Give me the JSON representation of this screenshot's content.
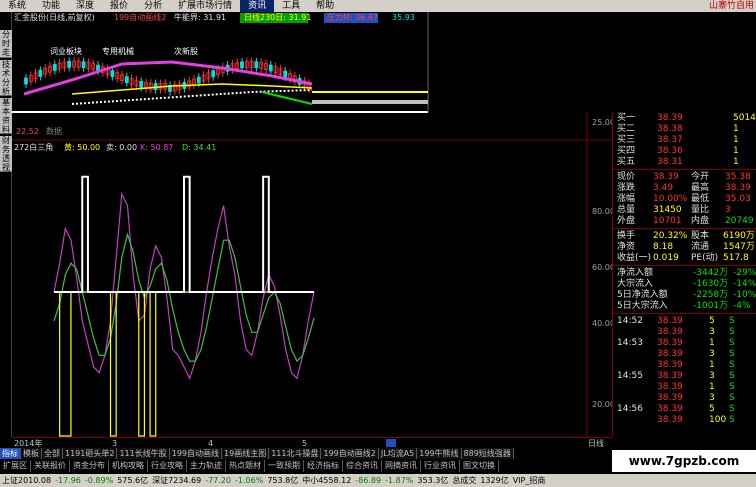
{
  "menu": {
    "items": [
      "系统",
      "功能",
      "深度",
      "报价",
      "分析",
      "扩展市场行情",
      "资讯",
      "工具",
      "帮助"
    ],
    "active_index": 6,
    "brand": "山寨竹自用"
  },
  "left_tabs": [
    "分时走势",
    "技术分析",
    "基本资料",
    "财务透视"
  ],
  "chart": {
    "title": "汇金股份(日线,前复权)",
    "indicator_name": "199自动画线2",
    "cow_label": "牛能界: 31.91",
    "day_line_label": "日线230日: 31.91",
    "pressure_label": "压力M: 36.67",
    "right_value": "35.93",
    "annotations": [
      "词业板块",
      "专用机械",
      "次新股"
    ],
    "top_axis_value": "25.00",
    "low_label": "22.52",
    "sub_label": "数据"
  },
  "osc": {
    "title": "272白三角",
    "buy_label": "黄: 50.00",
    "sell_label": "卖: 0.00",
    "k_label": "K: 50.87",
    "d_label": "D: 34.41",
    "y_ticks": [
      "80.00",
      "60.00",
      "40.00",
      "20.00"
    ]
  },
  "chart_data": {
    "type": "line",
    "ylim": [
      0,
      100
    ],
    "x_labels": [
      "2014年",
      "3",
      "4",
      "5"
    ],
    "period_label": "日线",
    "series": [
      {
        "name": "K",
        "color": "#c040c0",
        "values": [
          50,
          60,
          72,
          68,
          55,
          40,
          32,
          24,
          22,
          28,
          40,
          62,
          84,
          80,
          56,
          40,
          42,
          58,
          66,
          62,
          48,
          30,
          28,
          24,
          20,
          26,
          36,
          50,
          62,
          72,
          80,
          66,
          56,
          40,
          30,
          28,
          36,
          48,
          56,
          52,
          42,
          30,
          22,
          20,
          28,
          40,
          50
        ]
      },
      {
        "name": "D",
        "color": "#40c040",
        "values": [
          40,
          46,
          56,
          60,
          58,
          50,
          42,
          34,
          28,
          28,
          34,
          46,
          62,
          70,
          64,
          54,
          48,
          52,
          58,
          60,
          54,
          44,
          36,
          30,
          26,
          26,
          30,
          38,
          48,
          58,
          68,
          68,
          62,
          52,
          42,
          36,
          36,
          42,
          48,
          50,
          46,
          38,
          30,
          26,
          28,
          34,
          41
        ]
      },
      {
        "name": "黄",
        "color": "#ffff00",
        "values": [
          50,
          0,
          0,
          50,
          50,
          50,
          50,
          50,
          50,
          50,
          0,
          50,
          50,
          50,
          50,
          0,
          50,
          0,
          50,
          50,
          50,
          50,
          50,
          50,
          50,
          50,
          50,
          50,
          50,
          50,
          50,
          50,
          50,
          50,
          50,
          50,
          50,
          50,
          50,
          50,
          50,
          50,
          50,
          50,
          50,
          50,
          50
        ]
      },
      {
        "name": "白",
        "color": "#ffffff",
        "values": [
          50,
          50,
          50,
          50,
          50,
          90,
          50,
          50,
          50,
          50,
          50,
          50,
          50,
          50,
          50,
          50,
          50,
          50,
          50,
          50,
          50,
          50,
          50,
          90,
          50,
          50,
          50,
          50,
          50,
          50,
          50,
          50,
          50,
          50,
          50,
          50,
          50,
          90,
          50,
          50,
          50,
          50,
          50,
          50,
          50,
          50,
          50
        ]
      }
    ]
  },
  "quote": {
    "bid_ask": [
      {
        "label": "买一",
        "price": "38.39",
        "vol": "5014"
      },
      {
        "label": "买二",
        "price": "38.38",
        "vol": "1"
      },
      {
        "label": "买三",
        "price": "38.37",
        "vol": "1"
      },
      {
        "label": "买四",
        "price": "38.36",
        "vol": "1"
      },
      {
        "label": "买五",
        "price": "38.31",
        "vol": "1"
      }
    ],
    "stats": [
      {
        "l1": "现价",
        "v1": "38.39",
        "l2": "今开",
        "v2": "35.38"
      },
      {
        "l1": "涨跌",
        "v1": "3.49",
        "l2": "最高",
        "v2": "38.39"
      },
      {
        "l1": "涨幅",
        "v1": "10.00%",
        "l2": "最低",
        "v2": "35.03"
      },
      {
        "l1": "总量",
        "v1": "31450",
        "l2": "量比",
        "v2": "3"
      },
      {
        "l1": "外盘",
        "v1": "10701",
        "l2": "内盘",
        "v2": "20749"
      }
    ],
    "fund": [
      {
        "l1": "换手",
        "v1": "20.32%",
        "l2": "股本",
        "v2": "6190万"
      },
      {
        "l1": "净资",
        "v1": "8.18",
        "l2": "流通",
        "v2": "1547万"
      },
      {
        "l1": "收益(一)",
        "v1": "0.019",
        "l2": "PE(动)",
        "v2": "517.8"
      }
    ],
    "flows": [
      {
        "label": "净流入额",
        "v1": "-3442万",
        "v2": "-29%"
      },
      {
        "label": "大宗流入",
        "v1": "-1630万",
        "v2": "-14%"
      },
      {
        "label": "5日净流入额",
        "v1": "-2258万",
        "v2": "-10%"
      },
      {
        "label": "5日大宗流入",
        "v1": "-1001万",
        "v2": "-4%"
      }
    ],
    "ticks": [
      {
        "time": "14:52",
        "price": "38.39",
        "vol": "5",
        "side": "S"
      },
      {
        "time": "",
        "price": "38.39",
        "vol": "3",
        "side": "S"
      },
      {
        "time": "14:53",
        "price": "38.39",
        "vol": "1",
        "side": "S"
      },
      {
        "time": "",
        "price": "38.39",
        "vol": "3",
        "side": "S"
      },
      {
        "time": "",
        "price": "38.39",
        "vol": "1",
        "side": "S"
      },
      {
        "time": "14:55",
        "price": "38.39",
        "vol": "3",
        "side": "S"
      },
      {
        "time": "",
        "price": "38.39",
        "vol": "1",
        "side": "S"
      },
      {
        "time": "",
        "price": "38.39",
        "vol": "3",
        "side": "S"
      },
      {
        "time": "14:56",
        "price": "38.39",
        "vol": "5",
        "side": "S"
      },
      {
        "time": "",
        "price": "38.39",
        "vol": "100",
        "side": "S"
      }
    ]
  },
  "tabs": [
    "指标",
    "模板",
    "全部",
    "1191砸头单2",
    "111长线牛股",
    "199自动画线",
    "19画线主图",
    "111北斗操盘",
    "199自动画线2",
    "JL均流A5",
    "199牛熊线",
    "889短线强器"
  ],
  "nav": [
    "扩展区",
    "关联报价",
    "资金分布",
    "机构攻略",
    "行业攻略",
    "主力轨迹",
    "热点题材",
    "一致预期",
    "经济指标",
    "综合资讯",
    "网摘资讯",
    "行业资讯",
    "图文切换"
  ],
  "status": [
    {
      "text": "上证2010.08",
      "color": "#000"
    },
    {
      "text": "-17.96",
      "color": "#008000"
    },
    {
      "text": "-0.89%",
      "color": "#008000"
    },
    {
      "text": "575.6亿",
      "color": "#000"
    },
    {
      "text": "深证7234.69",
      "color": "#000"
    },
    {
      "text": "-77.20",
      "color": "#008000"
    },
    {
      "text": "-1.06%",
      "color": "#008000"
    },
    {
      "text": "753.8亿",
      "color": "#000"
    },
    {
      "text": "中小4558.12",
      "color": "#000"
    },
    {
      "text": "-86.89",
      "color": "#008000"
    },
    {
      "text": "-1.87%",
      "color": "#008000"
    },
    {
      "text": "353.3亿",
      "color": "#000"
    },
    {
      "text": "总成交",
      "color": "#000"
    },
    {
      "text": "1329亿",
      "color": "#000"
    },
    {
      "text": "VIP_招商",
      "color": "#000"
    }
  ],
  "watermark": "www.7gpzb.com"
}
